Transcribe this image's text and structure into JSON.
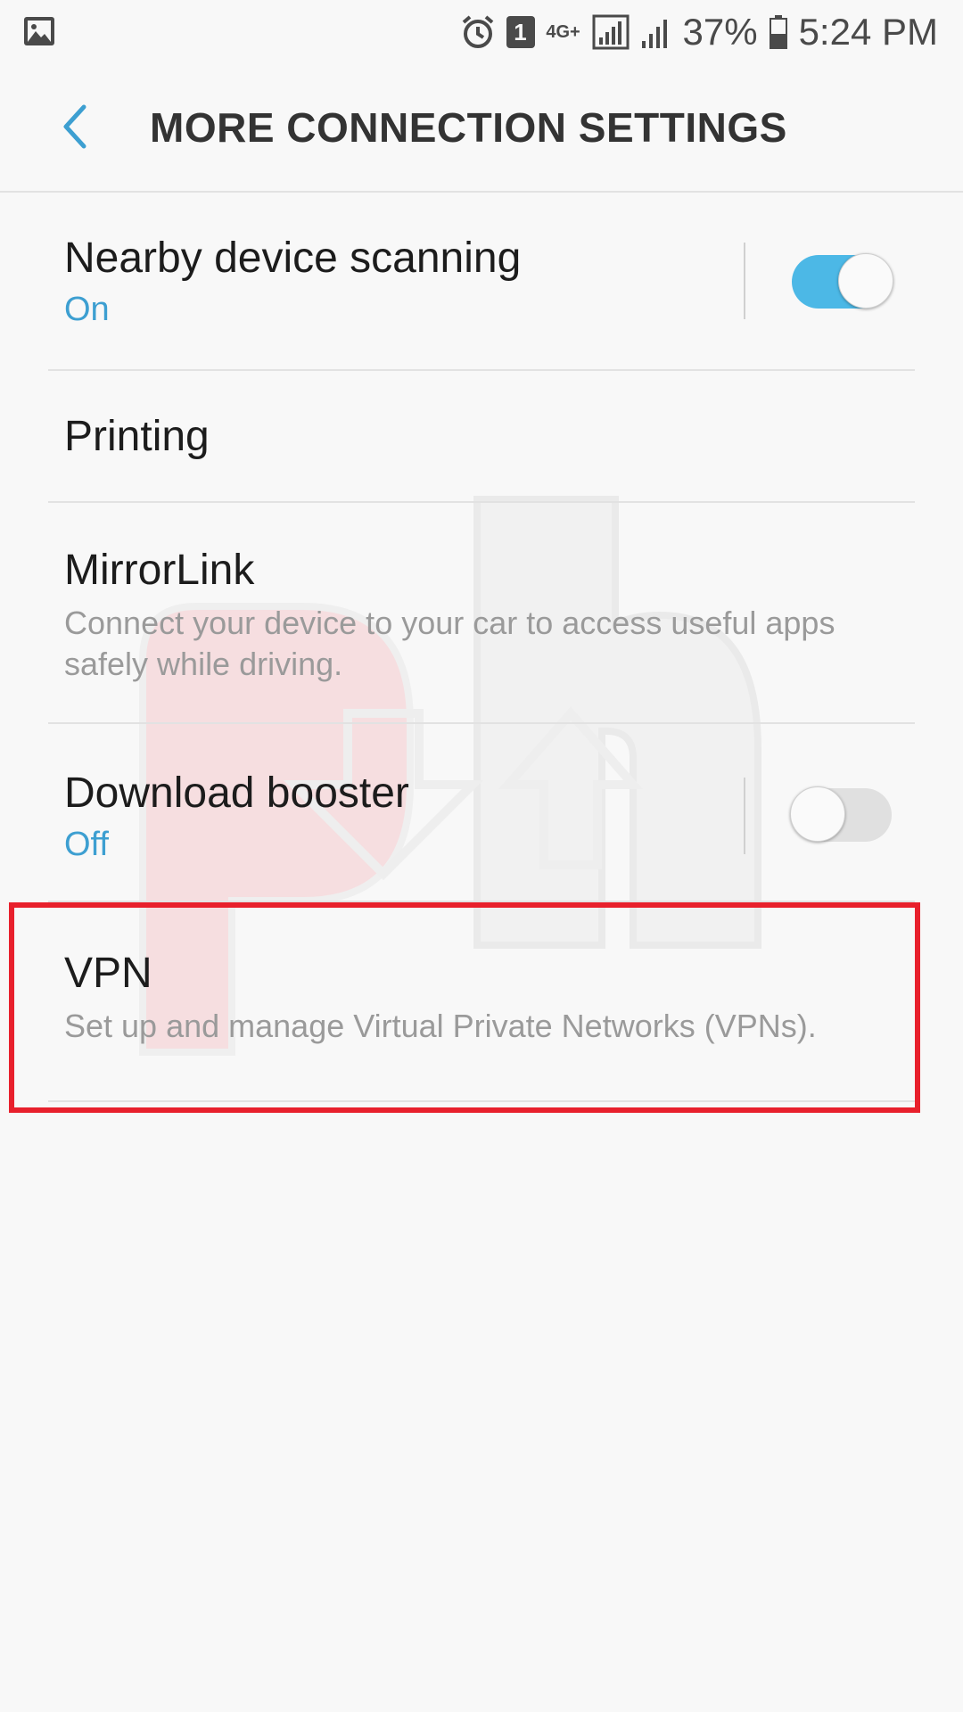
{
  "status_bar": {
    "battery": "37%",
    "time": "5:24 PM",
    "sim_badge": "1",
    "network": "4G+"
  },
  "header": {
    "title": "MORE CONNECTION SETTINGS"
  },
  "settings": {
    "nearby": {
      "title": "Nearby device scanning",
      "status": "On"
    },
    "printing": {
      "title": "Printing"
    },
    "mirrorlink": {
      "title": "MirrorLink",
      "subtitle": "Connect your device to your car to access useful apps safely while driving."
    },
    "download_booster": {
      "title": "Download booster",
      "status": "Off"
    },
    "vpn": {
      "title": "VPN",
      "subtitle": "Set up and manage Virtual Private Networks (VPNs)."
    }
  },
  "colors": {
    "accent": "#3d9fd1",
    "toggle_on": "#4cb8e6",
    "highlight": "#e8202c"
  }
}
